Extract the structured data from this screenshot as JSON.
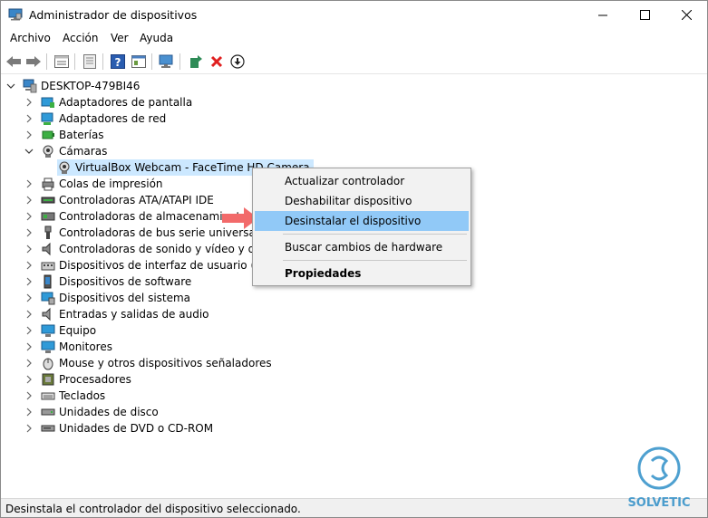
{
  "window": {
    "title": "Administrador de dispositivos"
  },
  "menu": [
    "Archivo",
    "Acción",
    "Ver",
    "Ayuda"
  ],
  "tree": {
    "root": "DESKTOP-479BI46",
    "items": [
      {
        "label": "Adaptadores de pantalla",
        "icon": "display-adapter-icon"
      },
      {
        "label": "Adaptadores de red",
        "icon": "network-adapter-icon"
      },
      {
        "label": "Baterías",
        "icon": "battery-icon"
      },
      {
        "label": "Cámaras",
        "icon": "camera-icon",
        "expanded": true
      },
      {
        "label": "VirtualBox Webcam - FaceTime HD Camera",
        "icon": "webcam-icon",
        "child": true,
        "selected": true
      },
      {
        "label": "Colas de impresión",
        "icon": "printer-icon"
      },
      {
        "label": "Controladoras ATA/ATAPI IDE",
        "icon": "ide-controller-icon"
      },
      {
        "label": "Controladoras de almacenamiento",
        "icon": "storage-controller-icon"
      },
      {
        "label": "Controladoras de bus serie universal",
        "icon": "usb-icon"
      },
      {
        "label": "Controladoras de sonido y vídeo y dispo",
        "icon": "speaker-icon"
      },
      {
        "label": "Dispositivos de interfaz de usuario (HID)",
        "icon": "hid-icon"
      },
      {
        "label": "Dispositivos de software",
        "icon": "software-device-icon"
      },
      {
        "label": "Dispositivos del sistema",
        "icon": "system-device-icon"
      },
      {
        "label": "Entradas y salidas de audio",
        "icon": "audio-io-icon"
      },
      {
        "label": "Equipo",
        "icon": "computer-icon"
      },
      {
        "label": "Monitores",
        "icon": "monitor-icon"
      },
      {
        "label": "Mouse y otros dispositivos señaladores",
        "icon": "mouse-icon"
      },
      {
        "label": "Procesadores",
        "icon": "processor-icon"
      },
      {
        "label": "Teclados",
        "icon": "keyboard-icon"
      },
      {
        "label": "Unidades de disco",
        "icon": "disk-drive-icon"
      },
      {
        "label": "Unidades de DVD o CD-ROM",
        "icon": "dvd-drive-icon"
      }
    ]
  },
  "context_menu": {
    "items": [
      {
        "label": "Actualizar controlador"
      },
      {
        "label": "Deshabilitar dispositivo"
      },
      {
        "label": "Desinstalar el dispositivo",
        "highlighted": true
      },
      {
        "label": "Buscar cambios de hardware"
      },
      {
        "label": "Propiedades",
        "bold": true
      }
    ]
  },
  "status": {
    "text": "Desinstala el controlador del dispositivo seleccionado."
  },
  "colors": {
    "selection": "#cce8ff",
    "menu_highlight": "#91c9f7",
    "arrow": "#f26a6a",
    "brand": "#2f8fc8"
  }
}
